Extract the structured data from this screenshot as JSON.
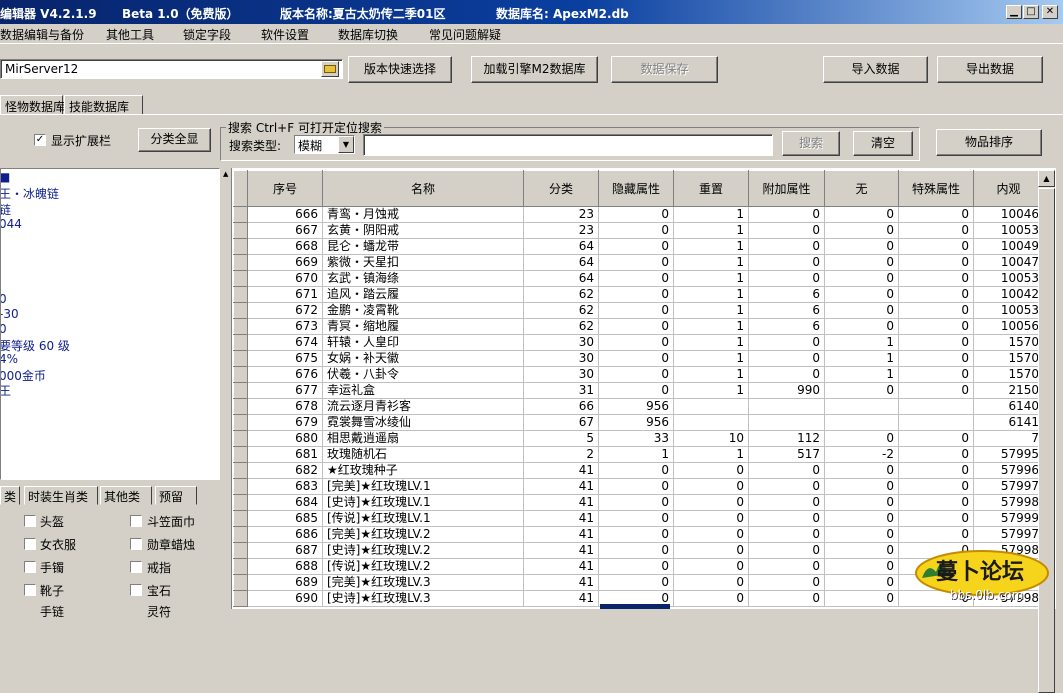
{
  "titlebar": {
    "app": "编辑器 V4.2.1.9",
    "beta": "Beta 1.0（免费版）",
    "version_label": "版本名称:夏古太奶传二季01区",
    "db_label": "数据库名: ApexM2.db",
    "min": "▁",
    "max": "□",
    "close": "✕"
  },
  "menu": [
    "数据编辑与备份",
    "其他工具",
    "锁定字段",
    "软件设置",
    "数据库切换",
    "常见问题解疑"
  ],
  "toolbar": {
    "server_value": "MirServer12",
    "version_select": "版本快速选择",
    "load_engine": "加载引擎M2数据库",
    "save_data": "数据保存",
    "import_data": "导入数据",
    "export_data": "导出数据"
  },
  "tabs": [
    "怪物数据库",
    "技能数据库"
  ],
  "left": {
    "show_ext": "显示扩展栏",
    "show_ext_check": "✓",
    "show_all": "分类全显",
    "tree_lines": [
      "■",
      "王・冰魄链",
      "链",
      "044",
      "",
      "",
      "",
      "0",
      "-30",
      "0",
      "要等级 60 级",
      " 4%",
      "000金币",
      "王"
    ],
    "bottom_tabs": [
      "类",
      "时装生肖类",
      "其他类",
      "预留"
    ],
    "categories": [
      [
        "头盔",
        "斗笠面巾"
      ],
      [
        "女衣服",
        "勋章蜡烛"
      ],
      [
        "手镯",
        "戒指"
      ],
      [
        "靴子",
        "宝石"
      ],
      [
        "手链",
        "灵符"
      ]
    ]
  },
  "search": {
    "title": "搜索  Ctrl+F 可打开定位搜索",
    "type_label": "搜索类型:",
    "type_value": "模糊",
    "query": "",
    "search_btn": "搜索",
    "clear_btn": "清空",
    "sort_btn": "物品排序"
  },
  "grid": {
    "columns": [
      "序号",
      "名称",
      "分类",
      "隐藏属性",
      "重置",
      "附加属性",
      "无",
      "特殊属性",
      "内观"
    ],
    "rows": [
      [
        "666",
        "青鸾・月蚀戒",
        "23",
        "0",
        "1",
        "0",
        "0",
        "0",
        "10046"
      ],
      [
        "667",
        "玄黄・阴阳戒",
        "23",
        "0",
        "1",
        "0",
        "0",
        "0",
        "10053"
      ],
      [
        "668",
        "昆仑・蟠龙带",
        "64",
        "0",
        "1",
        "0",
        "0",
        "0",
        "10049"
      ],
      [
        "669",
        "紫微・天星扣",
        "64",
        "0",
        "1",
        "0",
        "0",
        "0",
        "10047"
      ],
      [
        "670",
        "玄武・镇海绦",
        "64",
        "0",
        "1",
        "0",
        "0",
        "0",
        "10053"
      ],
      [
        "671",
        "追风・踏云履",
        "62",
        "0",
        "1",
        "6",
        "0",
        "0",
        "10042"
      ],
      [
        "672",
        "金鹏・凌霄靴",
        "62",
        "0",
        "1",
        "6",
        "0",
        "0",
        "10053"
      ],
      [
        "673",
        "青冥・缩地履",
        "62",
        "0",
        "1",
        "6",
        "0",
        "0",
        "10056"
      ],
      [
        "674",
        "轩辕・人皇印",
        "30",
        "0",
        "1",
        "0",
        "1",
        "0",
        "1570"
      ],
      [
        "675",
        "女娲・补天徽",
        "30",
        "0",
        "1",
        "0",
        "1",
        "0",
        "1570"
      ],
      [
        "676",
        "伏羲・八卦令",
        "30",
        "0",
        "1",
        "0",
        "1",
        "0",
        "1570"
      ],
      [
        "677",
        "幸运礼盒",
        "31",
        "0",
        "1",
        "990",
        "0",
        "0",
        "2150"
      ],
      [
        "678",
        "流云逐月青衫客",
        "66",
        "956",
        "",
        "",
        "",
        "",
        "6140"
      ],
      [
        "679",
        "霓裳舞雪冰绫仙",
        "67",
        "956",
        "",
        "",
        "",
        "",
        "6141"
      ],
      [
        "680",
        "相思戴逍遥扇",
        "5",
        "33",
        "10",
        "112",
        "0",
        "0",
        "7"
      ],
      [
        "681",
        "玫瑰随机石",
        "2",
        "1",
        "1",
        "517",
        "-2",
        "0",
        "57995"
      ],
      [
        "682",
        "★红玫瑰种子",
        "41",
        "0",
        "0",
        "0",
        "0",
        "0",
        "57996"
      ],
      [
        "683",
        "[完美]★红玫瑰LV.1",
        "41",
        "0",
        "0",
        "0",
        "0",
        "0",
        "57997"
      ],
      [
        "684",
        "[史诗]★红玫瑰LV.1",
        "41",
        "0",
        "0",
        "0",
        "0",
        "0",
        "57998"
      ],
      [
        "685",
        "[传说]★红玫瑰LV.1",
        "41",
        "0",
        "0",
        "0",
        "0",
        "0",
        "57999"
      ],
      [
        "686",
        "[完美]★红玫瑰LV.2",
        "41",
        "0",
        "0",
        "0",
        "0",
        "0",
        "57997"
      ],
      [
        "687",
        "[史诗]★红玫瑰LV.2",
        "41",
        "0",
        "0",
        "0",
        "0",
        "0",
        "57998"
      ],
      [
        "688",
        "[传说]★红玫瑰LV.2",
        "41",
        "0",
        "0",
        "0",
        "0",
        "0",
        "57999"
      ],
      [
        "689",
        "[完美]★红玫瑰LV.3",
        "41",
        "0",
        "0",
        "0",
        "0",
        "0",
        "57997"
      ],
      [
        "690",
        "[史诗]★红玫瑰LV.3",
        "41",
        "0",
        "0",
        "0",
        "0",
        "0",
        "57998"
      ]
    ]
  },
  "watermark": {
    "logo": "蔓卜论坛",
    "url": "bbs.0lb.com"
  }
}
